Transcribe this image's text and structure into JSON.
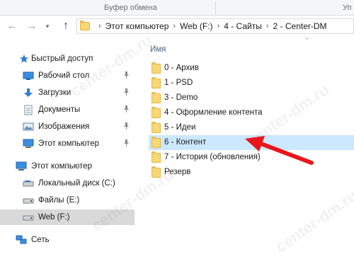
{
  "ribbon": {
    "clipboard": "Буфер обмена",
    "truncated": "Уп"
  },
  "nav_buttons": {
    "back": "←",
    "forward": "→",
    "recent": "▾",
    "up": "↑"
  },
  "address": {
    "crumbs": [
      "Этот компьютер",
      "Web (F:)",
      "4 - Сайты",
      "2 - Center-DM"
    ],
    "separator": "›"
  },
  "sidebar": {
    "items": [
      {
        "label": "Быстрый доступ",
        "icon": "star-icon",
        "pinned": false
      },
      {
        "label": "Рабочий стол",
        "icon": "desktop-icon",
        "pinned": true
      },
      {
        "label": "Загрузки",
        "icon": "download-arrow-icon",
        "pinned": true
      },
      {
        "label": "Документы",
        "icon": "documents-icon",
        "pinned": true
      },
      {
        "label": "Изображения",
        "icon": "pictures-icon",
        "pinned": true
      },
      {
        "label": "Этот компьютер",
        "icon": "computer-icon",
        "pinned": true
      },
      {
        "label": "Этот компьютер",
        "icon": "computer-icon",
        "pinned": false
      },
      {
        "label": "Локальный диск (C:)",
        "icon": "drive-icon",
        "pinned": false
      },
      {
        "label": "Файлы (E:)",
        "icon": "drive-icon",
        "pinned": false
      },
      {
        "label": "Web (F:)",
        "icon": "drive-icon",
        "pinned": false,
        "selected": true
      },
      {
        "label": "Сеть",
        "icon": "network-icon",
        "pinned": false
      }
    ],
    "pin_glyph": "📌"
  },
  "content": {
    "column_header": "Имя",
    "sort_glyph": "⌃",
    "files": [
      {
        "name": "0 - Архив"
      },
      {
        "name": "1 - PSD"
      },
      {
        "name": "3 - Demo"
      },
      {
        "name": "4 - Оформление контента"
      },
      {
        "name": "5 - Идеи"
      },
      {
        "name": "6 - Контент",
        "selected": true
      },
      {
        "name": "7 - История (обновления)"
      },
      {
        "name": "Резерв"
      }
    ]
  },
  "watermark": {
    "text": "center-dm.ru"
  },
  "colors": {
    "accent_selection": "#cce8ff",
    "nav_selection": "#d9d9d9",
    "arrow": "#e8161c",
    "folder": "#f8d775"
  }
}
